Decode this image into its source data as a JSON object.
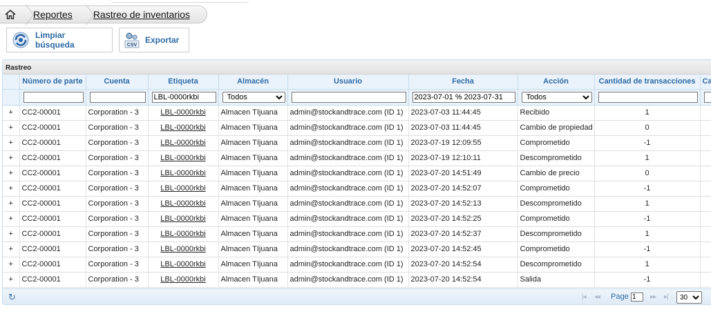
{
  "breadcrumb": {
    "items": [
      {
        "label": "Reportes"
      },
      {
        "label": "Rastreo de inventarios"
      }
    ]
  },
  "toolbar": {
    "clear_label": "Limpiar búsqueda",
    "export_label": "Exportar",
    "csv_text": "CSV"
  },
  "grid": {
    "caption": "Rastreo",
    "columns": [
      "Número de parte",
      "Cuenta",
      "Etiqueta",
      "Almacén",
      "Usuario",
      "Fecha",
      "Acción",
      "Cantidad de transacciones",
      "Ca"
    ],
    "filters": {
      "part": "",
      "account": "",
      "label": "LBL-0000rkbi",
      "warehouse": "Todos",
      "user": "",
      "date": "2023-07-01 % 2023-07-31",
      "action": "Todos",
      "qty": "",
      "extra": ""
    },
    "rows": [
      {
        "part": "CC2-00001",
        "account": "Corporation - 3",
        "label": "LBL-0000rkbi",
        "warehouse": "Almacen TIjuana",
        "user": "admin@stockandtrace.com (ID 1)",
        "date": "2023-07-03 11:44:45",
        "action": "Recibido",
        "qty": "1"
      },
      {
        "part": "CC2-00001",
        "account": "Corporation - 3",
        "label": "LBL-0000rkbi",
        "warehouse": "Almacen TIjuana",
        "user": "admin@stockandtrace.com (ID 1)",
        "date": "2023-07-03 11:44:45",
        "action": "Cambio de propiedad",
        "qty": "0"
      },
      {
        "part": "CC2-00001",
        "account": "Corporation - 3",
        "label": "LBL-0000rkbi",
        "warehouse": "Almacen TIjuana",
        "user": "admin@stockandtrace.com (ID 1)",
        "date": "2023-07-19 12:09:55",
        "action": "Comprometido",
        "qty": "-1"
      },
      {
        "part": "CC2-00001",
        "account": "Corporation - 3",
        "label": "LBL-0000rkbi",
        "warehouse": "Almacen TIjuana",
        "user": "admin@stockandtrace.com (ID 1)",
        "date": "2023-07-19 12:10:11",
        "action": "Descomprometido",
        "qty": "1"
      },
      {
        "part": "CC2-00001",
        "account": "Corporation - 3",
        "label": "LBL-0000rkbi",
        "warehouse": "Almacen TIjuana",
        "user": "admin@stockandtrace.com (ID 1)",
        "date": "2023-07-20 14:51:49",
        "action": "Cambio de precio",
        "qty": "0"
      },
      {
        "part": "CC2-00001",
        "account": "Corporation - 3",
        "label": "LBL-0000rkbi",
        "warehouse": "Almacen TIjuana",
        "user": "admin@stockandtrace.com (ID 1)",
        "date": "2023-07-20 14:52:07",
        "action": "Comprometido",
        "qty": "-1"
      },
      {
        "part": "CC2-00001",
        "account": "Corporation - 3",
        "label": "LBL-0000rkbi",
        "warehouse": "Almacen TIjuana",
        "user": "admin@stockandtrace.com (ID 1)",
        "date": "2023-07-20 14:52:13",
        "action": "Descomprometido",
        "qty": "1"
      },
      {
        "part": "CC2-00001",
        "account": "Corporation - 3",
        "label": "LBL-0000rkbi",
        "warehouse": "Almacen TIjuana",
        "user": "admin@stockandtrace.com (ID 1)",
        "date": "2023-07-20 14:52:25",
        "action": "Comprometido",
        "qty": "-1"
      },
      {
        "part": "CC2-00001",
        "account": "Corporation - 3",
        "label": "LBL-0000rkbi",
        "warehouse": "Almacen TIjuana",
        "user": "admin@stockandtrace.com (ID 1)",
        "date": "2023-07-20 14:52:37",
        "action": "Descomprometido",
        "qty": "1"
      },
      {
        "part": "CC2-00001",
        "account": "Corporation - 3",
        "label": "LBL-0000rkbi",
        "warehouse": "Almacen TIjuana",
        "user": "admin@stockandtrace.com (ID 1)",
        "date": "2023-07-20 14:52:45",
        "action": "Comprometido",
        "qty": "-1"
      },
      {
        "part": "CC2-00001",
        "account": "Corporation - 3",
        "label": "LBL-0000rkbi",
        "warehouse": "Almacen TIjuana",
        "user": "admin@stockandtrace.com (ID 1)",
        "date": "2023-07-20 14:52:54",
        "action": "Descomprometido",
        "qty": "1"
      },
      {
        "part": "CC2-00001",
        "account": "Corporation - 3",
        "label": "LBL-0000rkbi",
        "warehouse": "Almacen TIjuana",
        "user": "admin@stockandtrace.com (ID 1)",
        "date": "2023-07-20 14:52:54",
        "action": "Salida",
        "qty": "-1"
      }
    ]
  },
  "pager": {
    "page_label": "Page",
    "page_value": "1",
    "rows_per_page": "30"
  },
  "icons": {
    "home": "home-icon",
    "expand": "plus-icon",
    "refresh": "refresh-icon",
    "clear": "clear-search-icon",
    "export": "csv-icon"
  },
  "colors": {
    "accent": "#2e6aa6",
    "header_bg": "#eaf3fb",
    "border": "#c5dbec"
  }
}
